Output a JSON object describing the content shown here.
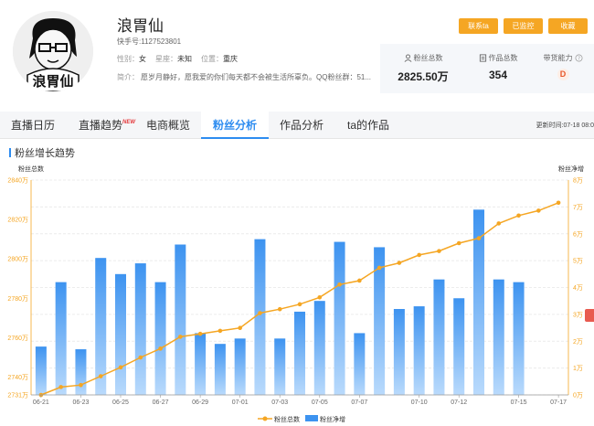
{
  "profile": {
    "name": "浪胃仙",
    "account_label": "快手号:",
    "account_id": "1127523801",
    "gender_label": "性别：",
    "gender": "女",
    "constellation_label": "星座：",
    "constellation": "未知",
    "location_label": "位置：",
    "location": "重庆",
    "bio_label": "简介：",
    "bio": "愿岁月静好，愿我爱的你们每天都不会被生活所辜负。QQ粉丝群：51..."
  },
  "actions": {
    "contact": "联系ta",
    "monitored": "已监控",
    "collect": "收藏"
  },
  "stats": {
    "fans_label": "粉丝总数",
    "fans_value": "2825.50万",
    "works_label": "作品总数",
    "works_value": "354",
    "ability_label": "带货能力",
    "ability_grade": "D"
  },
  "tabs": [
    {
      "label": "直播日历",
      "new": false,
      "active": false
    },
    {
      "label": "直播趋势",
      "new": true,
      "active": false
    },
    {
      "label": "电商概览",
      "new": false,
      "active": false
    },
    {
      "label": "粉丝分析",
      "new": false,
      "active": true
    },
    {
      "label": "作品分析",
      "new": false,
      "active": false
    },
    {
      "label": "ta的作品",
      "new": false,
      "active": false
    }
  ],
  "new_badge": "NEW",
  "updated_at": "更新时间:07-18 08:0",
  "section_title": "粉丝增长趋势",
  "colors": {
    "accent": "#2d8cf0",
    "button": "#f5a623",
    "line": "#f5a623",
    "bar_top": "#3d93f0",
    "bar_bottom": "#b9dafc"
  },
  "chart_data": {
    "type": "bar",
    "left_axis_title": "粉丝总数",
    "right_axis_title": "粉丝净增",
    "categories": [
      "06-21",
      "06-22",
      "06-23",
      "06-24",
      "06-25",
      "06-26",
      "06-27",
      "06-28",
      "06-29",
      "06-30",
      "07-01",
      "07-02",
      "07-03",
      "07-04",
      "07-05",
      "07-06",
      "07-07",
      "07-08",
      "07-09",
      "07-10",
      "07-11",
      "07-12",
      "07-13",
      "07-14",
      "07-15",
      "07-16",
      "07-17"
    ],
    "x_tick_labels": [
      "06-21",
      "06-23",
      "06-25",
      "06-27",
      "06-29",
      "07-01",
      "07-03",
      "07-05",
      "07-07",
      "07-10",
      "07-12",
      "07-15",
      "07-17"
    ],
    "x_tick_indices": [
      0,
      2,
      4,
      6,
      8,
      10,
      12,
      14,
      16,
      19,
      21,
      24,
      26
    ],
    "left_ticks": [
      "2731万",
      "2740万",
      "2760万",
      "2780万",
      "2800万",
      "2820万",
      "2840万"
    ],
    "left_tick_values": [
      2731,
      2740,
      2760,
      2780,
      2800,
      2820,
      2840
    ],
    "left_ylim": [
      2731,
      2840
    ],
    "right_ticks": [
      "0万",
      "1万",
      "2万",
      "3万",
      "4万",
      "5万",
      "6万",
      "7万",
      "8万"
    ],
    "right_tick_values": [
      0,
      1,
      2,
      3,
      4,
      5,
      6,
      7,
      8
    ],
    "right_ylim": [
      0,
      8
    ],
    "series": [
      {
        "name": "粉丝总数",
        "type": "line",
        "axis": "left",
        "values": [
          2731.0,
          2735.0,
          2736.0,
          2740.5,
          2745.0,
          2750.0,
          2754.5,
          2760.5,
          2762.0,
          2763.5,
          2765.0,
          2772.5,
          2774.5,
          2777.0,
          2780.5,
          2787.0,
          2789.0,
          2795.5,
          2798.0,
          2802.0,
          2804.0,
          2808.0,
          2810.5,
          2818.0,
          2822.0,
          2824.5,
          2828.5
        ]
      },
      {
        "name": "粉丝净增",
        "type": "bar",
        "axis": "right",
        "values": [
          1.8,
          4.2,
          1.7,
          5.1,
          4.5,
          4.9,
          4.2,
          5.6,
          2.3,
          1.9,
          2.1,
          5.8,
          2.1,
          3.1,
          3.5,
          5.7,
          2.3,
          5.5,
          3.2,
          3.3,
          4.3,
          3.6,
          6.9,
          4.3,
          4.2
        ]
      }
    ],
    "legend_position": "bottom-center",
    "grid": true
  }
}
